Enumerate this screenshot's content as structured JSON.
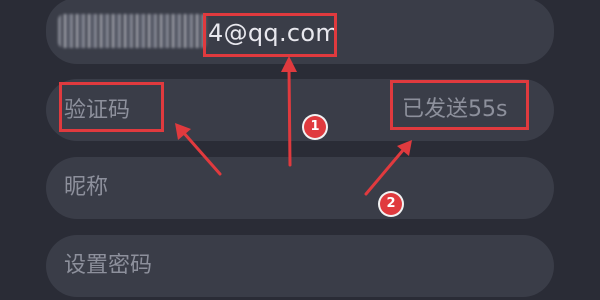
{
  "form": {
    "email": {
      "value": "4@qq.com"
    },
    "code": {
      "placeholder": "验证码",
      "send_status": "已发送55s"
    },
    "nickname": {
      "placeholder": "昵称"
    },
    "password": {
      "placeholder": "设置密码"
    }
  },
  "annotations": {
    "color": "#e03a3e",
    "badge_1": "1",
    "badge_2": "2"
  }
}
